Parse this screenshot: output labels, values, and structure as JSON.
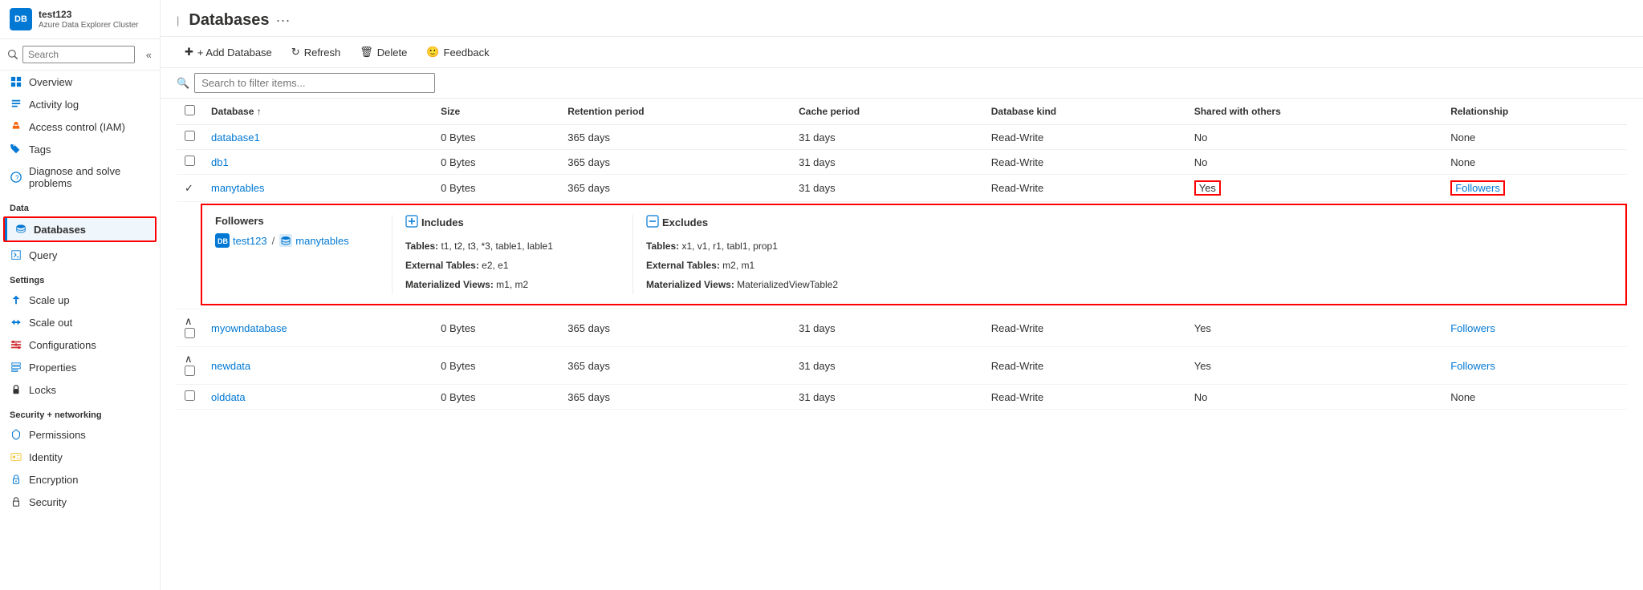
{
  "sidebar": {
    "logo_text": "DB",
    "title": "test123",
    "subtitle": "Azure Data Explorer Cluster",
    "search_placeholder": "Search",
    "nav_items": [
      {
        "id": "overview",
        "label": "Overview",
        "icon": "grid"
      },
      {
        "id": "activity-log",
        "label": "Activity log",
        "icon": "list"
      },
      {
        "id": "access-control",
        "label": "Access control (IAM)",
        "icon": "person"
      },
      {
        "id": "tags",
        "label": "Tags",
        "icon": "tag"
      },
      {
        "id": "diagnose",
        "label": "Diagnose and solve problems",
        "icon": "wrench"
      }
    ],
    "section_data": "Data",
    "data_items": [
      {
        "id": "databases",
        "label": "Databases",
        "icon": "database",
        "active": true
      },
      {
        "id": "query",
        "label": "Query",
        "icon": "query"
      }
    ],
    "section_settings": "Settings",
    "settings_items": [
      {
        "id": "scale-up",
        "label": "Scale up",
        "icon": "arrow-up"
      },
      {
        "id": "scale-out",
        "label": "Scale out",
        "icon": "arrows"
      },
      {
        "id": "configurations",
        "label": "Configurations",
        "icon": "sliders"
      },
      {
        "id": "properties",
        "label": "Properties",
        "icon": "info"
      },
      {
        "id": "locks",
        "label": "Locks",
        "icon": "lock"
      }
    ],
    "section_security": "Security + networking",
    "security_items": [
      {
        "id": "permissions",
        "label": "Permissions",
        "icon": "key"
      },
      {
        "id": "identity",
        "label": "Identity",
        "icon": "id"
      },
      {
        "id": "encryption",
        "label": "Encryption",
        "icon": "shield"
      },
      {
        "id": "security",
        "label": "Security",
        "icon": "lock-shield"
      }
    ]
  },
  "page": {
    "title": "Databases",
    "more_tooltip": "More"
  },
  "toolbar": {
    "add_database": "+ Add Database",
    "refresh": "Refresh",
    "delete": "Delete",
    "feedback": "Feedback"
  },
  "filter": {
    "placeholder": "Search to filter items..."
  },
  "table": {
    "columns": [
      "",
      "Database ↑",
      "Size",
      "Retention period",
      "Cache period",
      "Database kind",
      "Shared with others",
      "Relationship"
    ],
    "rows": [
      {
        "id": "database1",
        "name": "database1",
        "size": "0 Bytes",
        "retention": "365 days",
        "cache": "31 days",
        "kind": "Read-Write",
        "shared": "No",
        "relationship": "None",
        "expanded": false,
        "has_followers": false
      },
      {
        "id": "db1",
        "name": "db1",
        "size": "0 Bytes",
        "retention": "365 days",
        "cache": "31 days",
        "kind": "Read-Write",
        "shared": "No",
        "relationship": "None",
        "expanded": false,
        "has_followers": false
      },
      {
        "id": "manytables",
        "name": "manytables",
        "size": "0 Bytes",
        "retention": "365 days",
        "cache": "31 days",
        "kind": "Read-Write",
        "shared": "Yes",
        "relationship": "Followers",
        "expanded": true,
        "has_followers": true
      },
      {
        "id": "myowndatabase",
        "name": "myowndatabase",
        "size": "0 Bytes",
        "retention": "365 days",
        "cache": "31 days",
        "kind": "Read-Write",
        "shared": "Yes",
        "relationship": "Followers",
        "has_followers": true,
        "expanded": false
      },
      {
        "id": "newdata",
        "name": "newdata",
        "size": "0 Bytes",
        "retention": "365 days",
        "cache": "31 days",
        "kind": "Read-Write",
        "shared": "Yes",
        "relationship": "Followers",
        "has_followers": true,
        "expanded": false
      },
      {
        "id": "olddata",
        "name": "olddata",
        "size": "0 Bytes",
        "retention": "365 days",
        "cache": "31 days",
        "kind": "Read-Write",
        "shared": "No",
        "relationship": "None",
        "has_followers": false,
        "expanded": false
      }
    ],
    "followers_panel": {
      "col1_title": "Followers",
      "path_cluster": "test123",
      "path_db": "manytables",
      "col2_title": "Includes",
      "includes_tables": "Tables: t1, t2, t3, *3, table1, lable1",
      "includes_external": "External Tables: e2, e1",
      "includes_materialized": "Materialized Views: m1, m2",
      "col3_title": "Excludes",
      "excludes_tables": "Tables: x1, v1, r1, tabl1, prop1",
      "excludes_external": "External Tables: m2, m1",
      "excludes_materialized": "Materialized Views: MaterializedViewTable2"
    }
  }
}
